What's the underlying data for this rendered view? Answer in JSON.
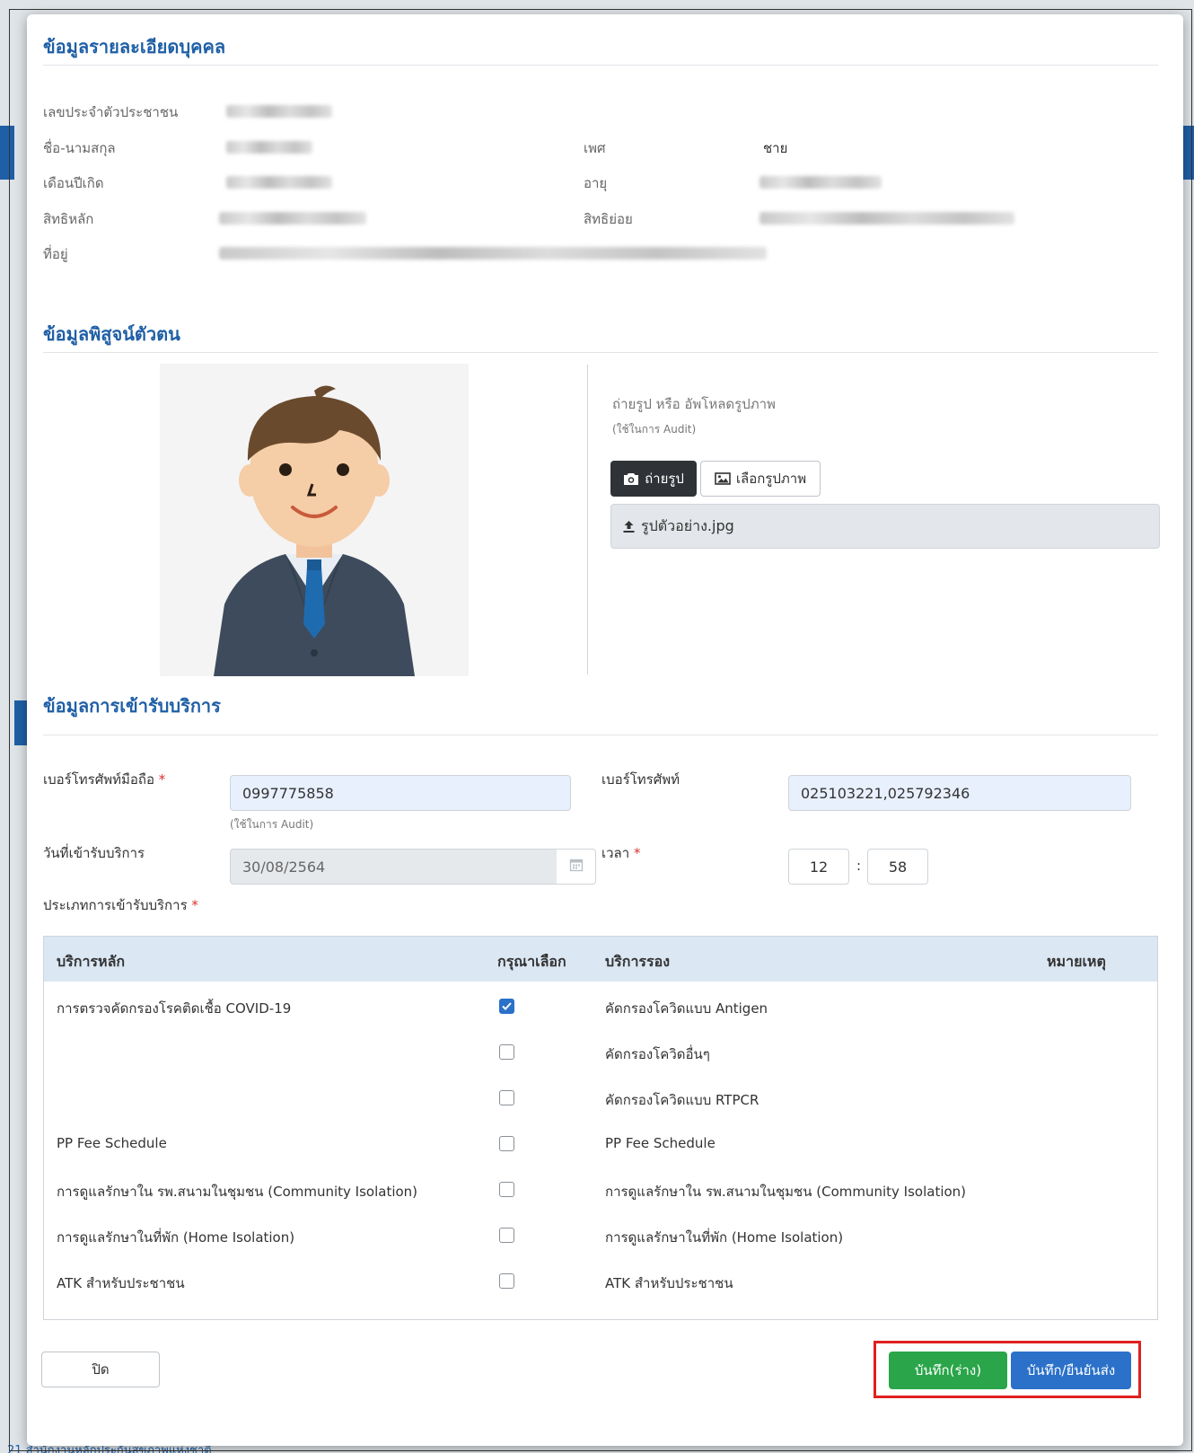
{
  "background": {
    "footer_text": "21 สำนักงานหลักประกันสุขภาพแห่งชาติ"
  },
  "modal": {
    "person_section": {
      "title": "ข้อมูลรายละเอียดบุคคล",
      "fields": {
        "citizen_id_label": "เลขประจำตัวประชาชน",
        "name_label": "ชื่อ-นามสกุล",
        "birth_label": "เดือนปีเกิด",
        "main_right_label": "สิทธิหลัก",
        "address_label": "ที่อยู่",
        "gender_label": "เพศ",
        "gender_value": "ชาย",
        "age_label": "อายุ",
        "sub_right_label": "สิทธิย่อย"
      }
    },
    "identity_section": {
      "title": "ข้อมูลพิสูจน์ตัวตน",
      "upload_hint": "ถ่ายรูป หรือ อัพโหลดรูปภาพ",
      "audit_note": "(ใช้ในการ Audit)",
      "take_photo_label": "ถ่ายรูป",
      "choose_image_label": "เลือกรูปภาพ",
      "file_name": "รูปตัวอย่าง.jpg"
    },
    "service_section": {
      "title": "ข้อมูลการเข้ารับบริการ",
      "mobile_label": "เบอร์โทรศัพท์มือถือ",
      "mobile_value": "0997775858",
      "mobile_note": "(ใช้ในการ Audit)",
      "phone_label": "เบอร์โทรศัพท์",
      "phone_value": "025103221,025792346",
      "date_label": "วันที่เข้ารับบริการ",
      "date_value": "30/08/2564",
      "time_label": "เวลา",
      "time_hour": "12",
      "time_sep": ":",
      "time_minute": "58",
      "service_type_label": "ประเภทการเข้ารับบริการ",
      "required_mark": "*",
      "table": {
        "headers": {
          "main": "บริการหลัก",
          "select": "กรุณาเลือก",
          "sub": "บริการรอง",
          "note": "หมายเหตุ"
        },
        "rows": [
          {
            "main": "การตรวจคัดกรองโรคติดเชื้อ COVID-19",
            "checked": true,
            "sub": "คัดกรองโควิดแบบ Antigen"
          },
          {
            "main": "",
            "checked": false,
            "sub": "คัดกรองโควิดอื่นๆ"
          },
          {
            "main": "",
            "checked": false,
            "sub": "คัดกรองโควิดแบบ RTPCR"
          },
          {
            "main": "PP Fee Schedule",
            "checked": false,
            "sub": "PP Fee Schedule"
          },
          {
            "main": "การดูแลรักษาใน รพ.สนามในชุมชน (Community Isolation)",
            "checked": false,
            "sub": "การดูแลรักษาใน รพ.สนามในชุมชน (Community Isolation)"
          },
          {
            "main": "การดูแลรักษาในที่พัก (Home Isolation)",
            "checked": false,
            "sub": "การดูแลรักษาในที่พัก (Home Isolation)"
          },
          {
            "main": "ATK สำหรับประชาชน",
            "checked": false,
            "sub": "ATK สำหรับประชาชน"
          }
        ]
      }
    },
    "footer": {
      "close_label": "ปิด",
      "save_draft_label": "บันทึก(ร่าง)",
      "save_submit_label": "บันทึก/ยืนยันส่ง"
    }
  },
  "colors": {
    "accent": "#1f5fa6",
    "primary_button": "#2b71c9",
    "success_button": "#2aa54a",
    "highlight": "#e02020"
  }
}
